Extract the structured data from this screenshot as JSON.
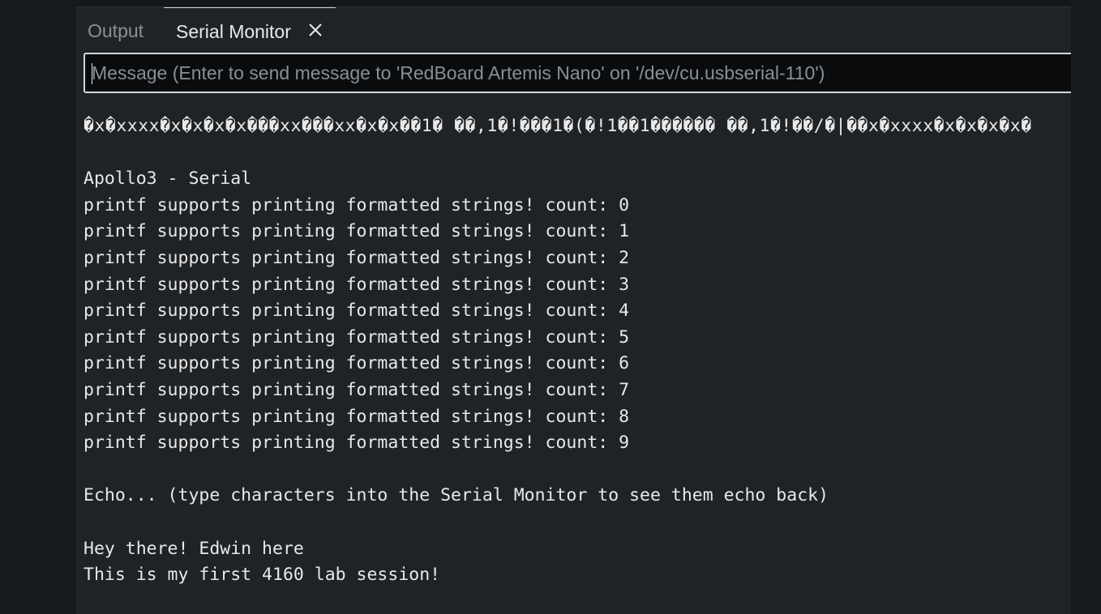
{
  "tabs": {
    "output_label": "Output",
    "serial_label": "Serial Monitor"
  },
  "input": {
    "placeholder": "Message (Enter to send message to 'RedBoard Artemis Nano' on '/dev/cu.usbserial-110')",
    "value": ""
  },
  "icons": {
    "tab_close": "close-icon"
  },
  "colors": {
    "background": "#202326",
    "text": "#e8e8e8",
    "tab_inactive": "#8b9096",
    "input_border": "#d3d6da"
  },
  "serial_output": {
    "lines": [
      "�x�xxxx�x�x�x�x���xx���xx�x�x��1� ��,1�!���1�(�!1��1������ ��,1�!��/�|��x�xxxx�x�x�x�x�",
      "",
      "Apollo3 - Serial",
      "printf supports printing formatted strings! count: 0",
      "printf supports printing formatted strings! count: 1",
      "printf supports printing formatted strings! count: 2",
      "printf supports printing formatted strings! count: 3",
      "printf supports printing formatted strings! count: 4",
      "printf supports printing formatted strings! count: 5",
      "printf supports printing formatted strings! count: 6",
      "printf supports printing formatted strings! count: 7",
      "printf supports printing formatted strings! count: 8",
      "printf supports printing formatted strings! count: 9",
      "",
      "Echo... (type characters into the Serial Monitor to see them echo back)",
      "",
      "Hey there! Edwin here",
      "This is my first 4160 lab session!"
    ]
  }
}
